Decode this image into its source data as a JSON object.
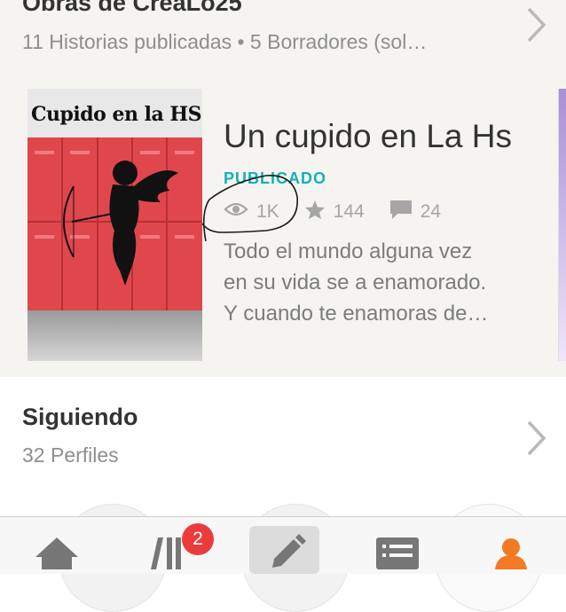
{
  "works": {
    "title": "Obras de CreaLo25",
    "subtitle": "11 Historias publicadas • 5 Borradores (sol…"
  },
  "story": {
    "cover_text": "Cupido en la HS",
    "title": "Un cupido en La Hs",
    "status": "PUBLICADO",
    "reads": "1K",
    "votes": "144",
    "comments": "24",
    "description": [
      "Todo el mundo alguna vez",
      "en su vida se a enamorado.",
      "Y cuando te enamoras de…"
    ]
  },
  "following": {
    "title": "Siguiendo",
    "subtitle": "32 Perfiles"
  },
  "tabbar": {
    "library_badge": "2",
    "active_tab": "write"
  },
  "colors": {
    "accent_status": "#13b1b5",
    "active_tab": "#f37a22",
    "badge": "#ec3b3b",
    "icon_gray": "#777777"
  },
  "icons": [
    "chevron-right-icon",
    "eye-icon",
    "star-icon",
    "comment-icon",
    "home-icon",
    "library-icon",
    "pencil-icon",
    "messages-icon",
    "profile-icon"
  ]
}
